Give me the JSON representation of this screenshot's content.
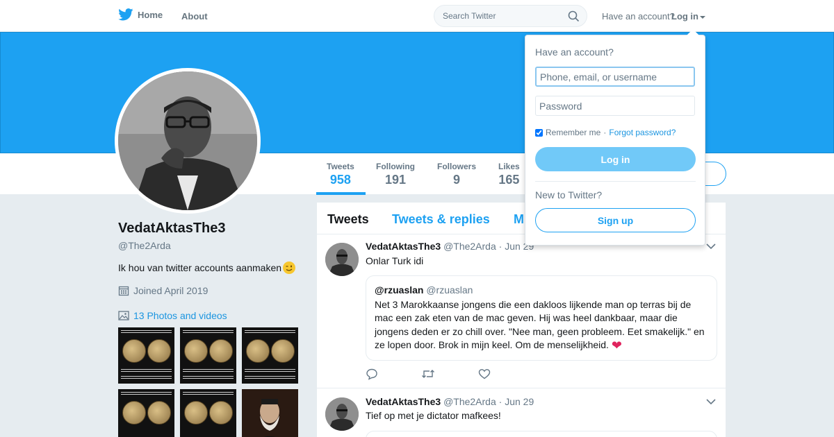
{
  "nav": {
    "home_label": "Home",
    "about_label": "About",
    "search_placeholder": "Search Twitter",
    "have_account": "Have an account?",
    "login_label": "Log in"
  },
  "stats": [
    {
      "label": "Tweets",
      "value": "958"
    },
    {
      "label": "Following",
      "value": "191"
    },
    {
      "label": "Followers",
      "value": "9"
    },
    {
      "label": "Likes",
      "value": "165"
    }
  ],
  "profile": {
    "name": "VedatAktasThe3",
    "handle": "@The2Arda",
    "bio": "Ik hou van twitter accounts aanmaken",
    "joined": "Joined April 2019",
    "photos": "13 Photos and videos"
  },
  "timeline": {
    "tabs": [
      "Tweets",
      "Tweets & replies",
      "M"
    ],
    "tweets": [
      {
        "name": "VedatAktasThe3",
        "handle": "@The2Arda",
        "date": "· Jun 29",
        "text": "Onlar Turk idi",
        "quote": {
          "name": "@rzuaslan",
          "handle": "@rzuaslan",
          "text": "Net 3 Marokkaanse jongens die een dakloos lijkende man op terras bij de mac een zak eten van de mac geven. Hij was heel dankbaar, maar die jongens deden er zo chill over. \"Nee man, geen probleem. Eet smakelijk.\" en ze lopen door. Brok in mijn keel. Om de menselijkheid."
        }
      },
      {
        "name": "VedatAktasThe3",
        "handle": "@The2Arda",
        "date": "· Jun 29",
        "text": "Tief op met je dictator mafkees!"
      }
    ]
  },
  "login_dropdown": {
    "title": "Have an account?",
    "username_placeholder": "Phone, email, or username",
    "password_placeholder": "Password",
    "remember_me": "Remember me",
    "separator": "·",
    "forgot_password": "Forgot password?",
    "login_button": "Log in",
    "new_to_twitter": "New to Twitter?",
    "signup_button": "Sign up"
  },
  "colors": {
    "accent": "#1da1f2",
    "banner": "#1da1f2",
    "login_button": "#71c9f8"
  }
}
